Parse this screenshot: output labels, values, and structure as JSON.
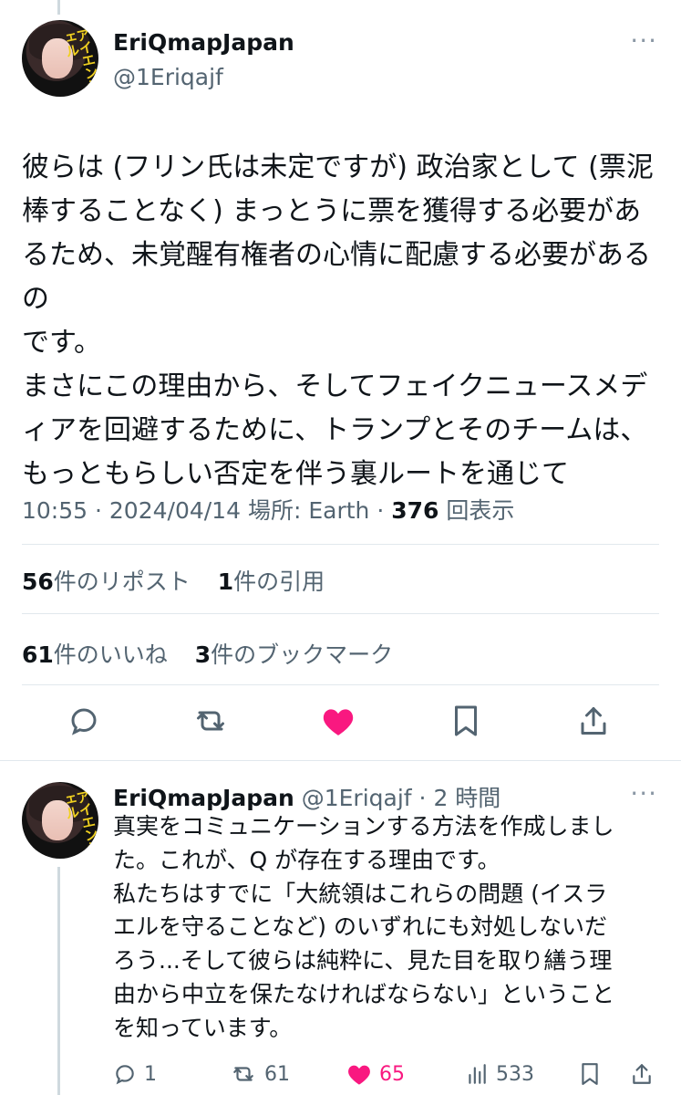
{
  "main_tweet": {
    "author_name": "EriQmapJapan",
    "handle": "@1Eriqajf",
    "avatar_text": "アイエンジェル",
    "text": "彼らは (フリン氏は未定ですが) 政治家として (票泥\n棒することなく) まっとうに票を獲得する必要があ\nるため、未覚醒有権者の心情に配慮する必要があるの\nです。\nまさにこの理由から、そしてフェイクニュースメデ\nィアを回避するために、トランプとそのチームは、\nもっともらしい否定を伴う裏ルートを通じて",
    "time": "10:55",
    "date": "2024/04/14",
    "location_label": "場所: Earth",
    "views_count": "376",
    "views_label": "回表示",
    "reposts_count": "56",
    "reposts_label": "件のリポスト",
    "quotes_count": "1",
    "quotes_label": "件の引用",
    "likes_count": "61",
    "likes_label": "件のいいね",
    "bookmarks_count": "3",
    "bookmarks_label": "件のブックマーク",
    "more_label": "···"
  },
  "reply_tweet": {
    "author_name": "EriQmapJapan",
    "handle": "@1Eriqajf",
    "time_ago": "2 時間",
    "text": "真実をコミュニケーションする方法を作成しまし\nた。これが、Q が存在する理由です。\n私たちはすでに「大統領はこれらの問題 (イスラ\nエルを守ることなど) のいずれにも対処しないだ\nろう...そして彼らは純粋に、見た目を取り繕う理\n由から中立を保たなければならない」ということ\nを知っています。",
    "replies": "1",
    "reposts": "61",
    "likes": "65",
    "views": "533",
    "more_label": "···"
  },
  "colors": {
    "like": "#f91880",
    "muted": "#536471",
    "icon": "#536471"
  }
}
